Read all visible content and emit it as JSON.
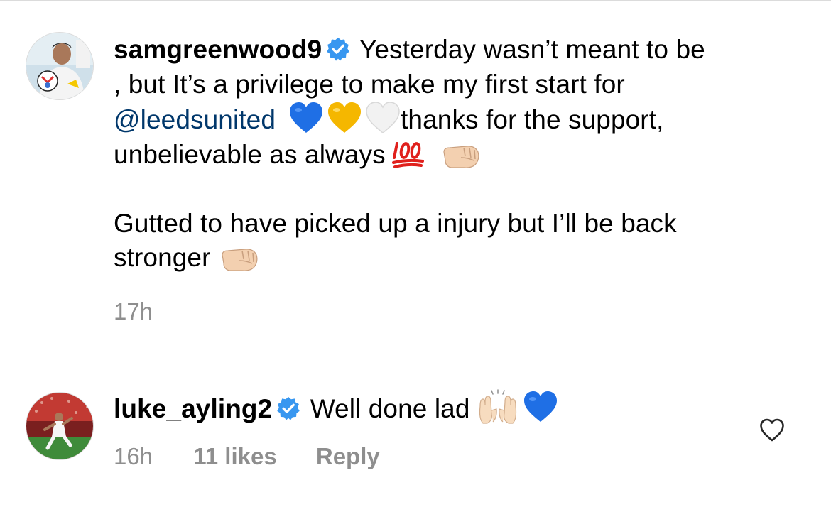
{
  "comments": [
    {
      "username": "samgreenwood9",
      "lines": [
        "Yesterday wasn’t meant to be",
        ", but It’s a privilege to make my first start for",
        "@leedsunited",
        "thanks for the support,",
        "unbelievable as always",
        "Gutted to have picked up a injury but I’ll be back",
        "stronger"
      ],
      "time": "17h"
    },
    {
      "username": "luke_ayling2",
      "text": "Well done lad",
      "time": "16h",
      "likes": "11 likes",
      "reply_label": "Reply"
    }
  ],
  "icons": {
    "verified": "verified-badge-icon",
    "heart_blue": "blue-heart-emoji",
    "heart_yellow": "yellow-heart-emoji",
    "heart_white": "white-heart-emoji",
    "hundred": "hundred-points-emoji",
    "fist": "right-facing-fist-emoji",
    "raised_hands": "raising-hands-emoji",
    "like": "heart-outline-icon"
  },
  "colors": {
    "verified": "#3897f0",
    "mention": "#00376b",
    "meta": "#8e8e8e",
    "divider": "#dbdbdb"
  }
}
